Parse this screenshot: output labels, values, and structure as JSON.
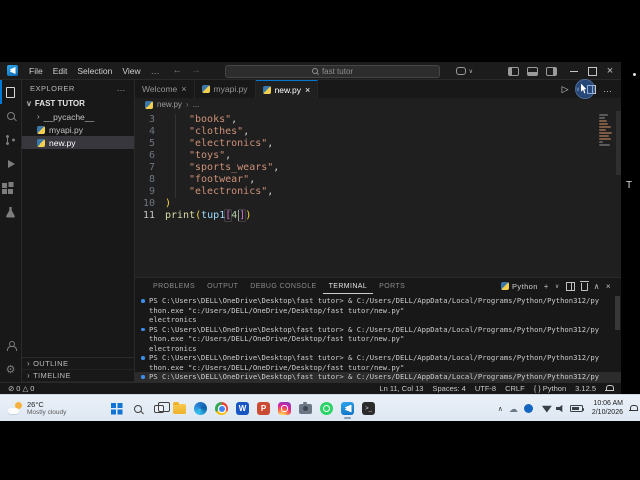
{
  "titlebar": {
    "menus": [
      "File",
      "Edit",
      "Selection",
      "View"
    ],
    "search_text": "fast tutor"
  },
  "sidebar": {
    "header": "EXPLORER",
    "root_folder": "FAST TUTOR",
    "files": [
      {
        "label": "__pycache__"
      },
      {
        "label": "myapi.py"
      },
      {
        "label": "new.py"
      }
    ],
    "sections": [
      {
        "label": "OUTLINE"
      },
      {
        "label": "TIMELINE"
      }
    ]
  },
  "tabs": [
    {
      "label": "Welcome"
    },
    {
      "label": "myapi.py"
    },
    {
      "label": "new.py"
    }
  ],
  "breadcrumb": {
    "file": "new.py",
    "symbol": "..."
  },
  "code": {
    "lines": [
      {
        "num": "3",
        "string": "\"books\"",
        "comma": ","
      },
      {
        "num": "4",
        "string": "\"clothes\"",
        "comma": ","
      },
      {
        "num": "5",
        "string": "\"electronics\"",
        "comma": ","
      },
      {
        "num": "6",
        "string": "\"toys\"",
        "comma": ","
      },
      {
        "num": "7",
        "string": "\"sports_wears\"",
        "comma": ","
      },
      {
        "num": "8",
        "string": "\"footwear\"",
        "comma": ","
      },
      {
        "num": "9",
        "string": "\"electronics\"",
        "comma": ","
      }
    ],
    "close_line": {
      "num": "10",
      "paren": ")"
    },
    "print_line": {
      "num": "11",
      "fn": "print",
      "open": "(",
      "var": "tup1",
      "lbracket": "[",
      "index": "4",
      "rbracket": "]",
      "close": ")"
    }
  },
  "panel": {
    "tabs": [
      "PROBLEMS",
      "OUTPUT",
      "DEBUG CONSOLE",
      "TERMINAL",
      "PORTS"
    ],
    "terminal_name": "Python"
  },
  "terminal": {
    "rows": [
      {
        "text": "PS C:\\Users\\DELL\\OneDrive\\Desktop\\fast tutor> & C:/Users/DELL/AppData/Local/Programs/Python/Python312/py"
      },
      {
        "text": "thon.exe \"c:/Users/DELL/OneDrive/Desktop/fast tutor/new.py\""
      },
      {
        "text": "electronics"
      },
      {
        "text": "PS C:\\Users\\DELL\\OneDrive\\Desktop\\fast tutor> & C:/Users/DELL/AppData/Local/Programs/Python/Python312/py"
      },
      {
        "text": "thon.exe \"c:/Users/DELL/OneDrive/Desktop/fast tutor/new.py\""
      },
      {
        "text": "electronics"
      },
      {
        "text": "PS C:\\Users\\DELL\\OneDrive\\Desktop\\fast tutor> & C:/Users/DELL/AppData/Local/Programs/Python/Python312/py"
      },
      {
        "text": "thon.exe \"c:/Users/DELL/OneDrive/Desktop/fast tutor/new.py\""
      },
      {
        "text": "PS C:\\Users\\DELL\\OneDrive\\Desktop\\fast tutor> & C:/Users/DELL/AppData/Local/Programs/Python/Python312/py"
      }
    ]
  },
  "status_bar": {
    "errors": "0",
    "warnings": "0",
    "cursor_position": "Ln 11, Col 13",
    "indentation": "Spaces: 4",
    "encoding": "UTF-8",
    "eol": "CRLF",
    "language_icon": "{ }",
    "language": "Python",
    "python_version": "3.12.5"
  },
  "taskbar": {
    "weather_temp": "26°C",
    "weather_desc": "Mostly cloudy",
    "time": "10:06 AM",
    "date": "2/10/2026"
  },
  "overlay": {
    "right_edge_label": "T"
  },
  "colors": {
    "accent": "#0078d4",
    "string": "#ce9178",
    "function": "#dcdcaa",
    "variable": "#9cdcfe",
    "number": "#b5cea8"
  }
}
